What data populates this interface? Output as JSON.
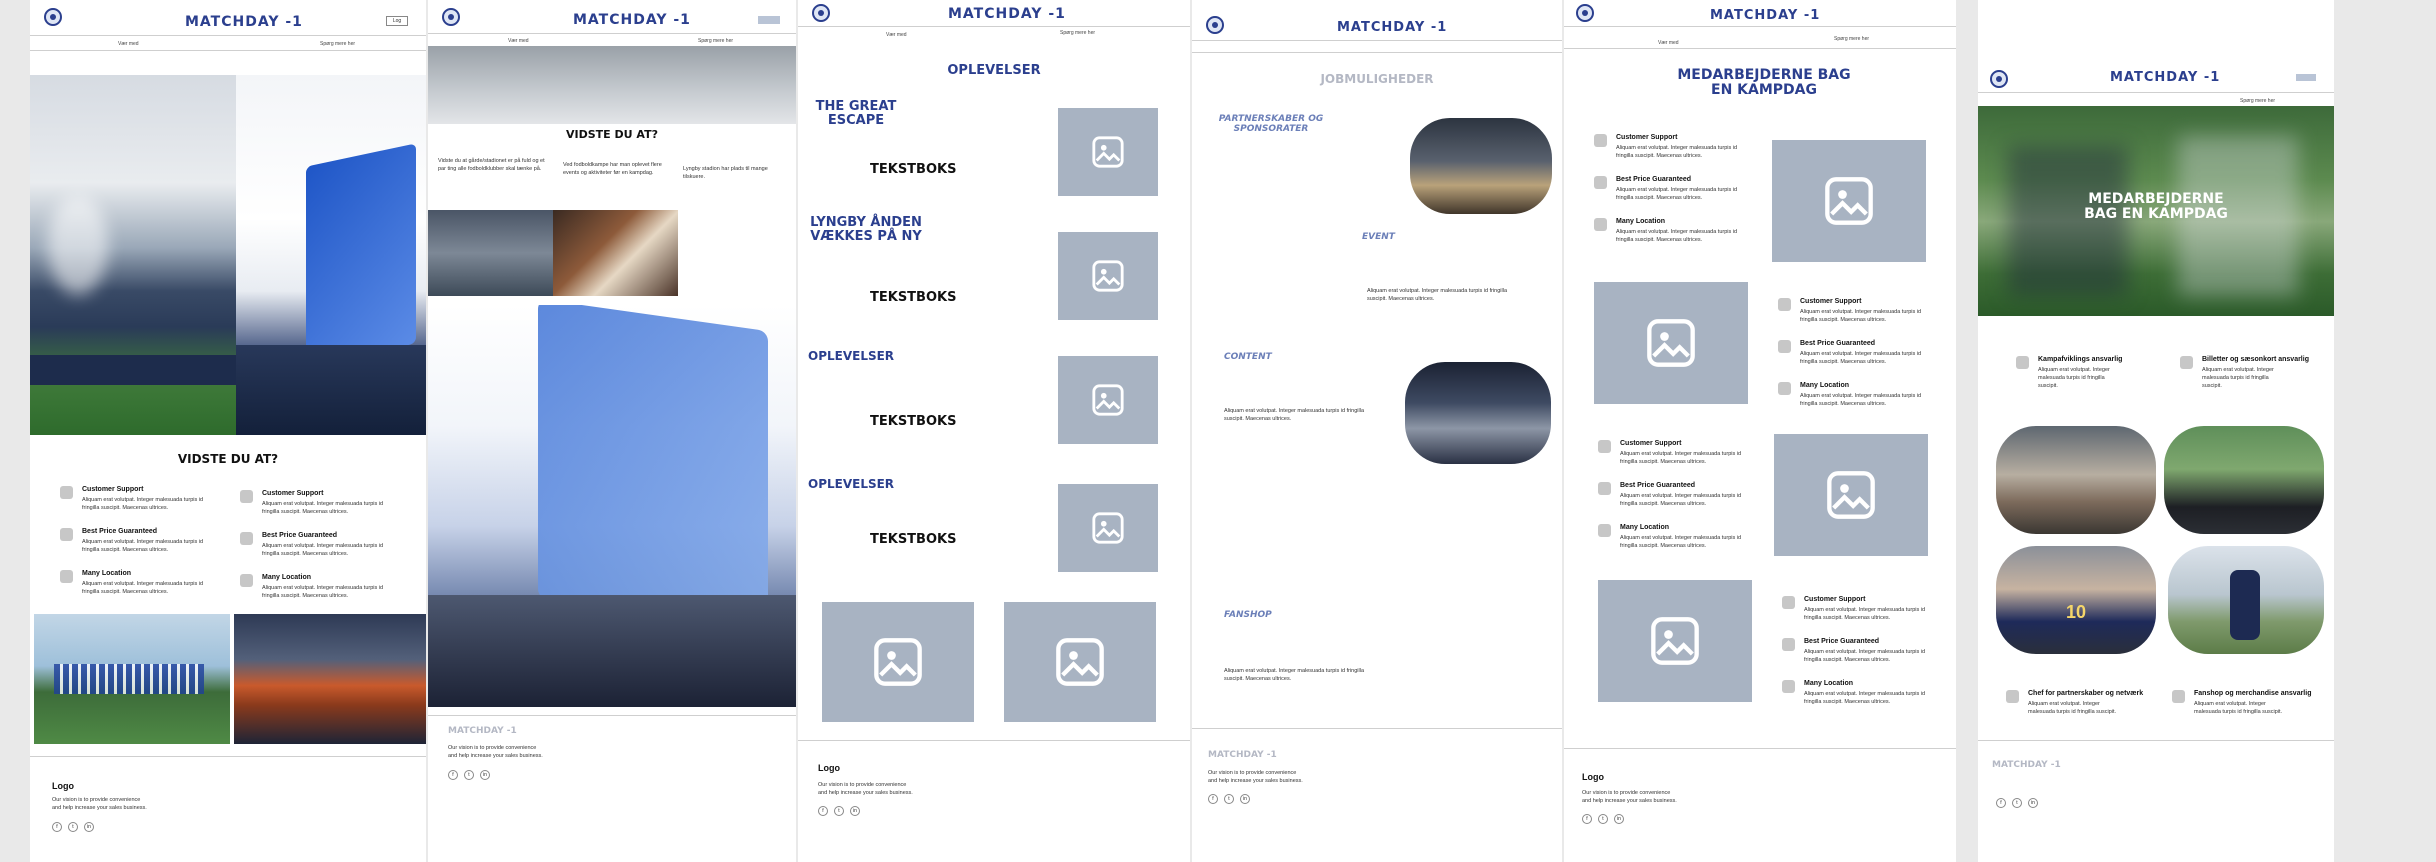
{
  "brand": "MATCHDAY -1",
  "nav": {
    "left": "Vær med",
    "right": "Spørg mere her"
  },
  "header_button": "Log",
  "footer": {
    "logo": "Logo",
    "text_line1": "Our vision is to provide convenience",
    "text_line2": "and help increase your sales business.",
    "social": [
      "f",
      "t",
      "in"
    ],
    "brand_muted": "MATCHDAY -1"
  },
  "features": [
    {
      "title": "Customer Support",
      "body": "Aliquam erat volutpat. Integer malesuada turpis id fringilla suscipit. Maecenas ultrices."
    },
    {
      "title": "Best Price Guaranteed",
      "body": "Aliquam erat volutpat. Integer malesuada turpis id fringilla suscipit. Maecenas ultrices."
    },
    {
      "title": "Many Location",
      "body": "Aliquam erat volutpat. Integer malesuada turpis id fringilla suscipit. Maecenas ultrices."
    }
  ],
  "p1": {
    "heading": "VIDSTE DU AT?"
  },
  "p2": {
    "heading": "VIDSTE DU AT?",
    "col1": "Vidste du at gårde/stadionet er på fuld og et par ting alle fodboldklubber skal tænke på.",
    "col2": "Ved fodboldkampe har man oplevet flere events og aktiviteter før en kampdag.",
    "col3": "Lyngby stadion har plads til mange tilskuere."
  },
  "p3": {
    "title": "OPLEVELSER",
    "sections": [
      {
        "heading": "THE GREAT ESCAPE",
        "text": "TEKSTBOKS"
      },
      {
        "heading": "LYNGBY ÅNDEN VÆKKES PÅ NY",
        "text": "TEKSTBOKS"
      },
      {
        "heading": "OPLEVELSER",
        "text": "TEKSTBOKS"
      },
      {
        "heading": "OPLEVELSER",
        "text": "TEKSTBOKS"
      }
    ]
  },
  "p4": {
    "title": "JOBMULIGHEDER",
    "partner": "PARTNERSKABER OG SPONSORATER",
    "event": "EVENT",
    "event_text": "Aliquam erat volutpat. Integer malesuada turpis id fringilla suscipit. Maecenas ultrices.",
    "content": "CONTENT",
    "content_text": "Aliquam erat volutpat. Integer malesuada turpis id fringilla suscipit. Maecenas ultrices.",
    "fanshop": "FANSHOP",
    "fanshop_text": "Aliquam erat volutpat. Integer malesuada turpis id fringilla suscipit. Maecenas ultrices."
  },
  "p5": {
    "heading": "MEDARBEJDERNE BAG EN KAMPDAG"
  },
  "p6": {
    "hero_text": "MEDARBEJDERNE BAG EN KAMPDAG",
    "nav": "Spørg mere her",
    "roles": [
      {
        "title": "Kampafviklings ansvarlig",
        "body": "Aliquam erat volutpat. Integer malesuada turpis id fringilla suscipit."
      },
      {
        "title": "Billetter og sæsonkort ansvarlig",
        "body": "Aliquam erat volutpat. Integer malesuada turpis id fringilla suscipit."
      },
      {
        "title": "Chef for partnerskaber og netværk",
        "body": "Aliquam erat volutpat. Integer malesuada turpis id fringilla suscipit."
      },
      {
        "title": "Fanshop og merchandise ansvarlig",
        "body": "Aliquam erat volutpat. Integer malesuada turpis id fringilla suscipit."
      }
    ],
    "jersey_number": "10"
  },
  "colors": {
    "brand": "#2b3f8e",
    "placeholder": "#a8b3c2",
    "muted": "#b4b8c4"
  },
  "icons": [
    "club-logo-icon",
    "image-placeholder-icon",
    "feature-icon",
    "social-icon"
  ]
}
